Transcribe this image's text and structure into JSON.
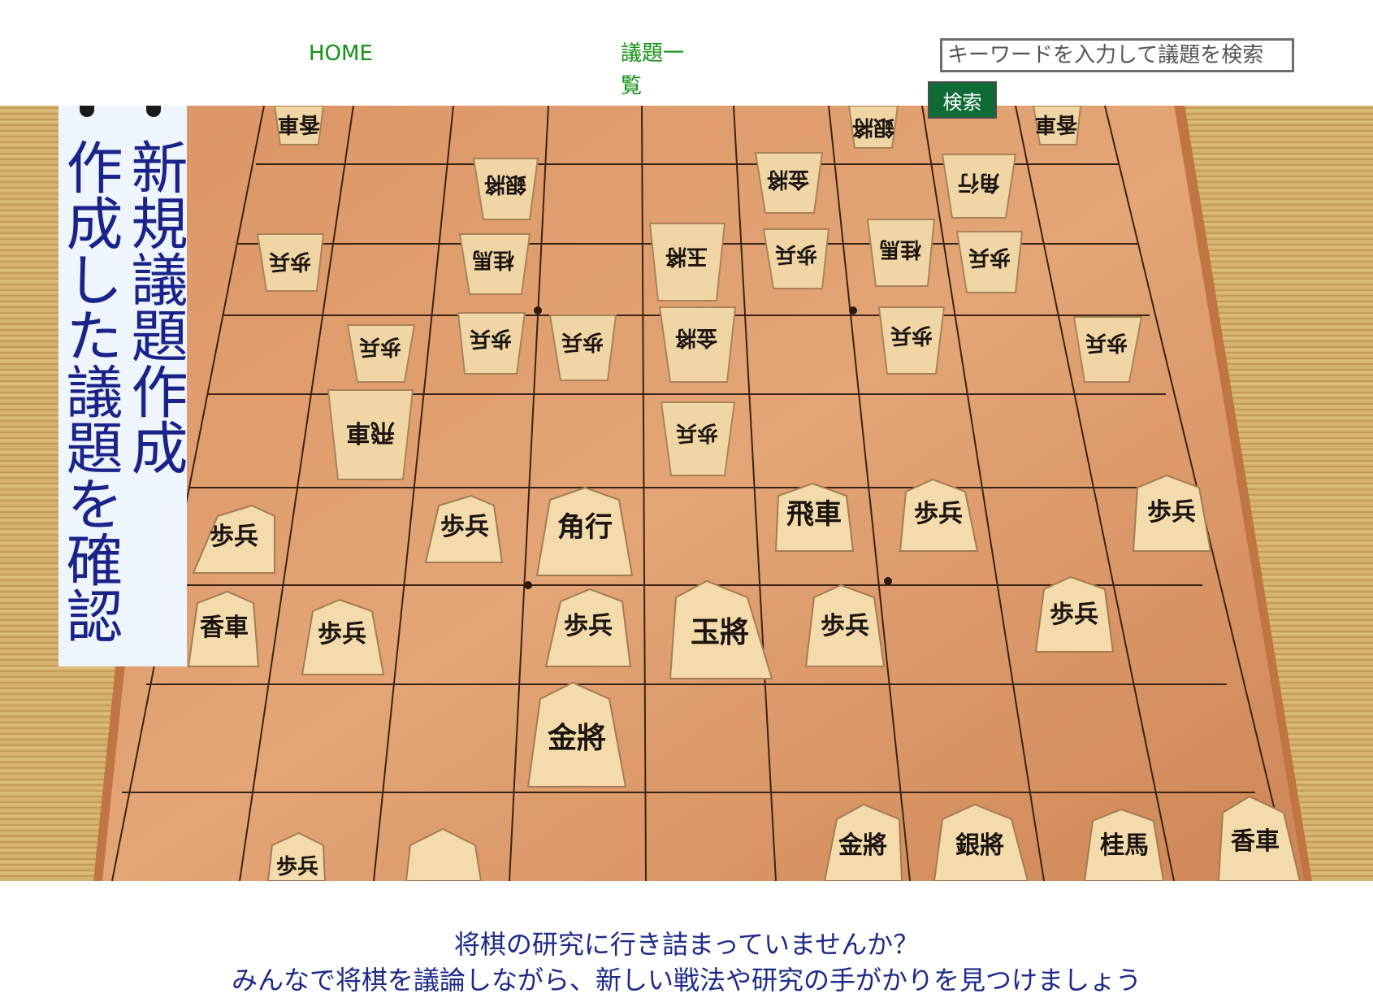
{
  "nav": {
    "home_label": "HOME",
    "topic_list_label": "議題一覧"
  },
  "search": {
    "placeholder": "キーワードを入力して議題を検索",
    "button_label": "検索"
  },
  "side_menu": {
    "items": [
      {
        "label": "新規議題作成"
      },
      {
        "label": "作成した議題を確認"
      }
    ]
  },
  "hero": {
    "pieces": {
      "p1": "香車",
      "p2": "歩兵",
      "p3": "歩兵",
      "p4": "角行",
      "p5": "歩兵",
      "p6": "歩兵",
      "p7": "歩兵",
      "p8": "玉將",
      "p9": "歩兵",
      "p10": "歩兵",
      "p11": "金將",
      "p12": "飛車",
      "p13": "歩兵",
      "p14": "歩兵",
      "p15": "金將",
      "p16": "銀將",
      "p17": "桂馬",
      "p18": "香車"
    }
  },
  "intro": {
    "line1": "将棋の研究に行き詰まっていませんか？",
    "line2": "みんなで将棋を議論しながら、新しい戦法や研究の手がかりを見つけましょう"
  },
  "colors": {
    "nav_link": "#119211",
    "search_button_bg": "#0f6b35",
    "side_menu_text": "#1a238a",
    "side_menu_bg": "#eef5fd",
    "intro_text": "#1d2a8a"
  }
}
